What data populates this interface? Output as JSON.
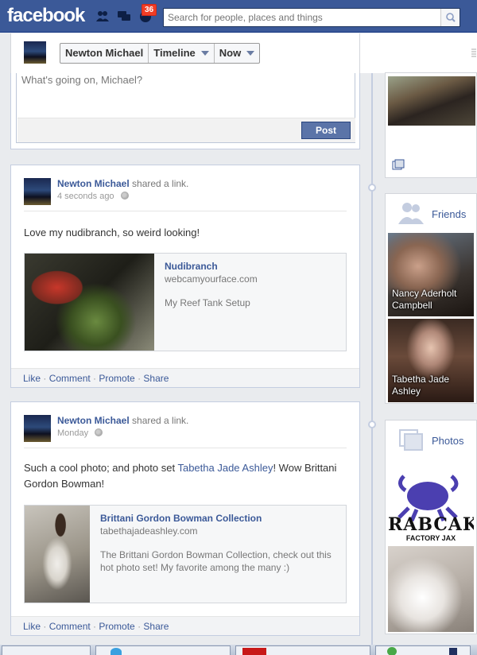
{
  "topbar": {
    "logo": "facebook",
    "notifications_count": "36",
    "search_placeholder": "Search for people, places and things",
    "icons": [
      "friends-icon",
      "messages-icon",
      "notifications-icon",
      "search-icon"
    ]
  },
  "header": {
    "name": "Newton Michael",
    "timeline_label": "Timeline",
    "now_label": "Now"
  },
  "composer": {
    "placeholder": "What's going on, Michael?",
    "post_label": "Post"
  },
  "stories": [
    {
      "author": "Newton Michael",
      "verb": " shared a link.",
      "time": "4 seconds ago",
      "message": "Love my nudibranch, so weird looking!",
      "link_title": "Nudibranch",
      "link_host": "webcamyourface.com",
      "link_desc": "My Reef Tank Setup",
      "actions": [
        "Like",
        "Comment",
        "Promote",
        "Share"
      ]
    },
    {
      "author": "Newton Michael",
      "verb": " shared a link.",
      "time": "Monday",
      "message_pre": "Such a cool photo; and photo set ",
      "message_link": "Tabetha Jade Ashley",
      "message_post": "! Wow Brittani Gordon Bowman!",
      "link_title": "Brittani Gordon Bowman Collection",
      "link_host": "tabethajadeashley.com",
      "link_desc": "The Brittani Gordon Bowman Collection, check out this hot photo set! My favorite among the many :)",
      "actions": [
        "Like",
        "Comment",
        "Promote",
        "Share"
      ]
    }
  ],
  "sidebar": {
    "friends_title": "Friends",
    "friends": [
      "Nancy Aderholt Campbell",
      "Tabetha Jade Ashley"
    ],
    "photos_title": "Photos",
    "photo_banner_lines": [
      "RABCAK",
      "FACTORY JAX"
    ]
  },
  "colors": {
    "brand": "#3b5998",
    "badge": "#f03d25",
    "post_button": "#5b74a8"
  }
}
